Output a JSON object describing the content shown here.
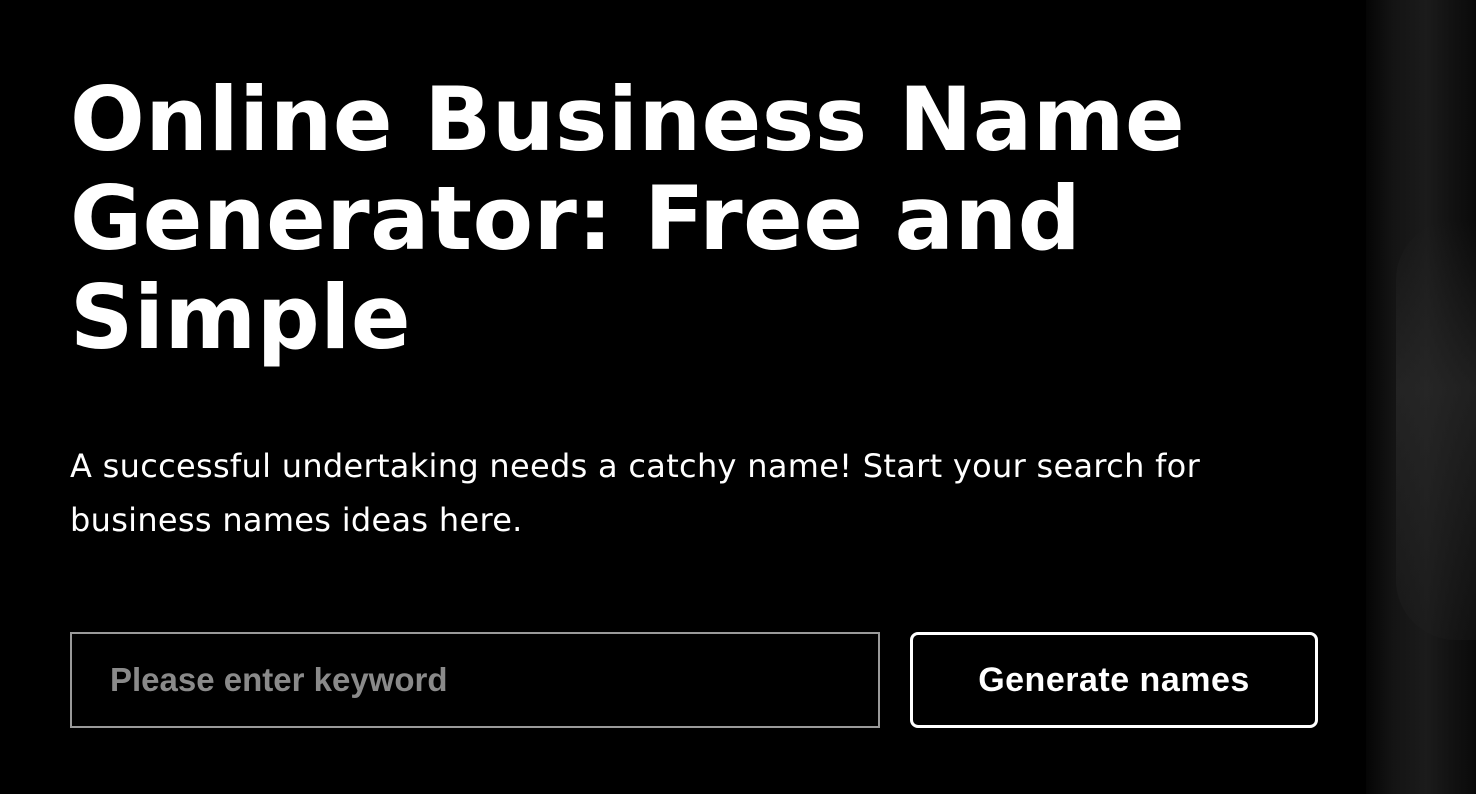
{
  "hero": {
    "title": "Online Business Name Generator: Free and Simple",
    "subtitle": "A successful undertaking needs a catchy name! Start your search for business names ideas here."
  },
  "search": {
    "placeholder": "Please enter keyword",
    "value": "",
    "button_label": "Generate names"
  },
  "colors": {
    "background": "#000000",
    "text": "#ffffff",
    "input_border": "#9a9a9a",
    "placeholder": "#8a8a8a"
  }
}
